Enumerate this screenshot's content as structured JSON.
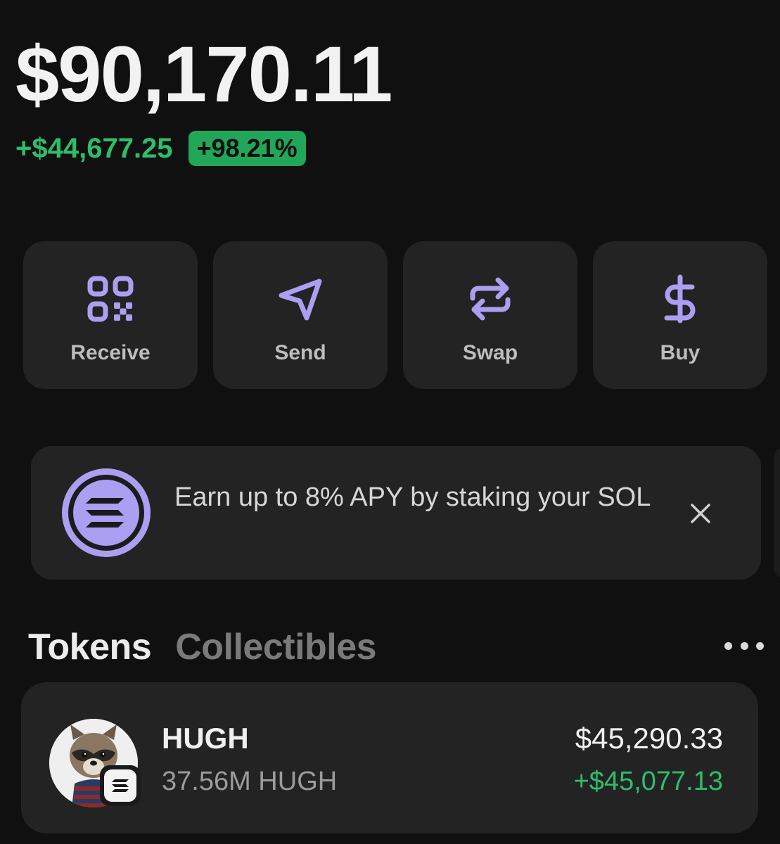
{
  "portfolio": {
    "balance": "$90,170.11",
    "change_amount": "+$44,677.25",
    "change_percent": "+98.21%"
  },
  "actions": [
    {
      "label": "Receive",
      "icon": "qr-code-icon"
    },
    {
      "label": "Send",
      "icon": "send-icon"
    },
    {
      "label": "Swap",
      "icon": "swap-icon"
    },
    {
      "label": "Buy",
      "icon": "dollar-icon"
    }
  ],
  "banner": {
    "text": "Earn up to 8% APY by staking your SOL",
    "logo_icon": "solana-logo-icon",
    "close_icon": "close-icon"
  },
  "tabs": [
    {
      "label": "Tokens",
      "active": true
    },
    {
      "label": "Collectibles",
      "active": false
    }
  ],
  "more_icon": "more-dots-icon",
  "tokens": [
    {
      "name": "HUGH",
      "amount": "37.56M HUGH",
      "value": "$45,290.33",
      "change": "+$45,077.13",
      "avatar": "raccoon-avatar",
      "chain_badge": "solana-badge-icon"
    }
  ],
  "colors": {
    "background": "#101010",
    "card": "#232323",
    "accent_purple": "#ab9ff2",
    "positive_green": "#2dbe6c",
    "pill_green": "#21a65a"
  }
}
